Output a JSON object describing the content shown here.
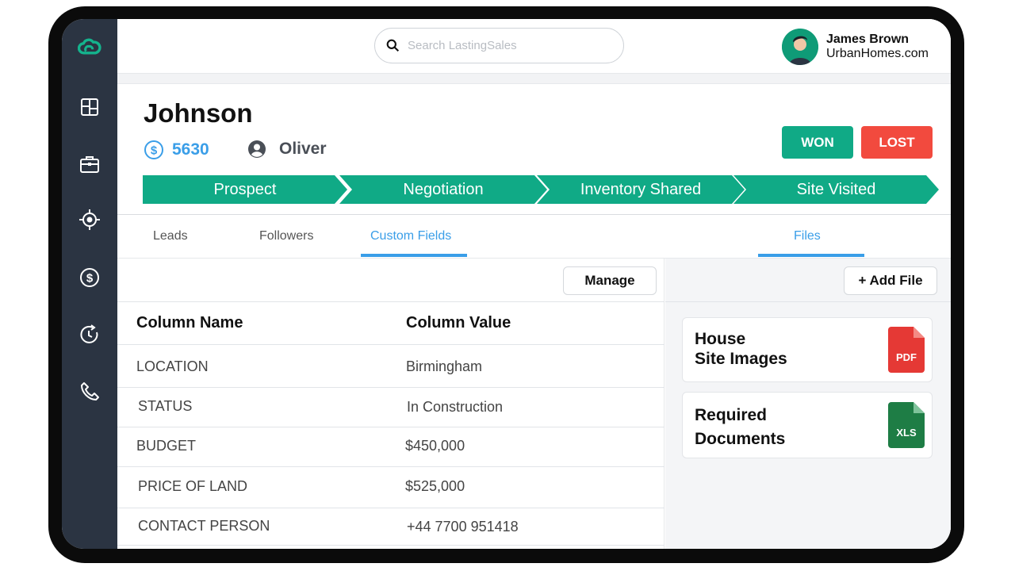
{
  "app": {
    "search_placeholder": "Search LastingSales",
    "accent_green": "#10aa86",
    "accent_blue": "#3a9ee8",
    "accent_red": "#f24a3e",
    "sidebar_color": "#2b3442"
  },
  "sidebar": {
    "items": [
      {
        "icon": "logo-cloud-icon"
      },
      {
        "icon": "dashboard-icon"
      },
      {
        "icon": "briefcase-icon"
      },
      {
        "icon": "target-icon"
      },
      {
        "icon": "dollar-icon"
      },
      {
        "icon": "history-icon"
      },
      {
        "icon": "phone-icon"
      }
    ]
  },
  "user": {
    "name": "James Brown",
    "company": "UrbanHomes.com"
  },
  "deal": {
    "title": "Johnson",
    "amount": "5630",
    "owner": "Oliver",
    "won_label": "WON",
    "lost_label": "LOST"
  },
  "pipeline": {
    "stages": [
      "Prospect",
      "Negotiation",
      "Inventory Shared",
      "Site Visited"
    ]
  },
  "tabs": {
    "leads": "Leads",
    "followers": "Followers",
    "custom_fields": "Custom Fields",
    "files": "Files",
    "active": "Custom Fields"
  },
  "custom_fields": {
    "manage_label": "Manage",
    "headers": [
      "Column Name",
      "Column Value"
    ],
    "rows": [
      {
        "name": "LOCATION",
        "value": "Birmingham"
      },
      {
        "name": "STATUS",
        "value": "In Construction"
      },
      {
        "name": "BUDGET",
        "value": "$450,000"
      },
      {
        "name": "PRICE OF LAND",
        "value": "$525,000"
      },
      {
        "name": "CONTACT PERSON",
        "value": "+44 7700 951418"
      }
    ]
  },
  "files": {
    "add_label": "+  Add File",
    "items": [
      {
        "line1": "House",
        "line2": "Site Images",
        "type": "PDF",
        "color": "#e53935"
      },
      {
        "line1": "Required",
        "line2": "Documents",
        "type": "XLS",
        "color": "#1e7d45"
      }
    ]
  }
}
